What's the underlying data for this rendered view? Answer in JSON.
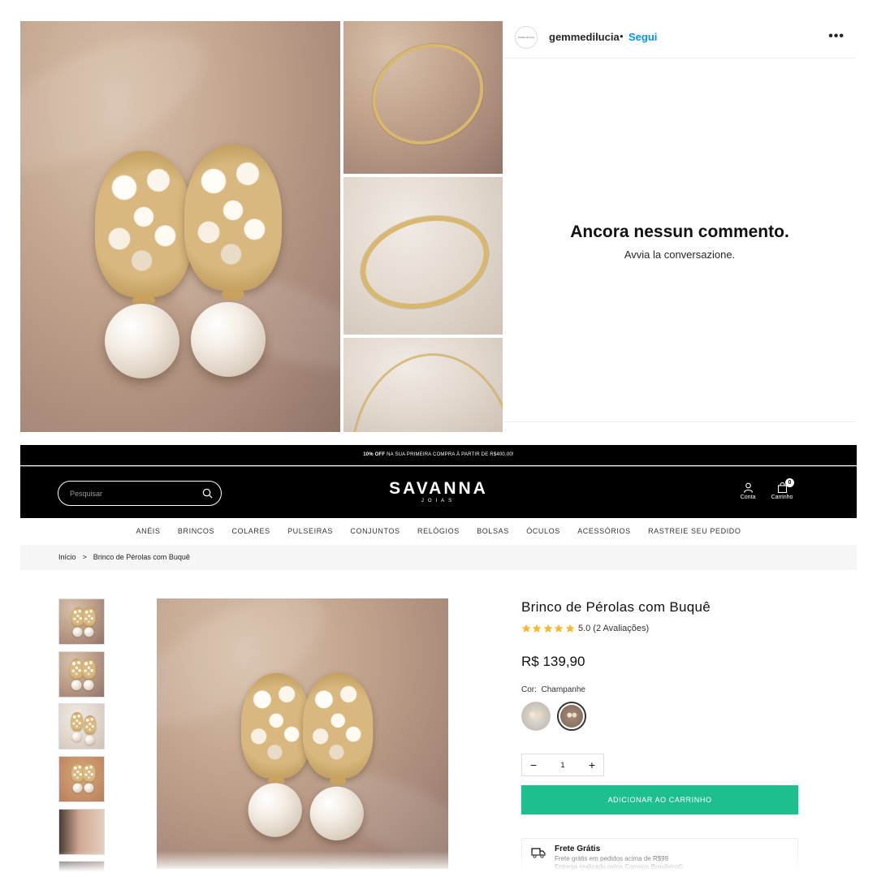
{
  "instagram": {
    "username": "gemmedilucia",
    "separator": "•",
    "follow_label": "Segui",
    "more_icon": "•••",
    "avatar_text": "Gemme di Lucia",
    "empty_title": "Ancora nessun commento.",
    "empty_subtitle": "Avvia la conversazione."
  },
  "store": {
    "promo_bold": "10% OFF",
    "promo_text": " NA SUA PRIMEIRA COMPRA À PARTIR DE R$400,00!",
    "search_placeholder": "Pesquisar",
    "logo_main": "SAVANNA",
    "logo_sub": "JOIAS",
    "account_label": "Conta",
    "cart_label": "Carrinho",
    "cart_count": "0",
    "nav": [
      "ANÉIS",
      "BRINCOS",
      "COLARES",
      "PULSEIRAS",
      "CONJUNTOS",
      "RELÓGIOS",
      "BOLSAS",
      "ÓCULOS",
      "ACESSÓRIOS",
      "RASTREIE SEU PEDIDO"
    ],
    "breadcrumb": {
      "home": "Início",
      "sep": ">",
      "current": "Brinco de Pérolas com Buquê"
    },
    "accent_color": "#1dbf8f"
  },
  "product": {
    "title": "Brinco de Pérolas com Buquê",
    "rating": 5,
    "rating_text": "5.0 (2 Avaliações)",
    "price": "R$ 139,90",
    "color_label": "Cor:",
    "color_value": "Champanhe",
    "quantity": "1",
    "minus": "−",
    "plus": "+",
    "add_to_cart": "ADICIONAR AO CARRINHO",
    "shipping": {
      "title": "Frete Grátis",
      "line1": "Frete grátis em pedidos acima de R$99",
      "line2": "Entrega realizado pelos Correios Brasileiro©."
    }
  }
}
